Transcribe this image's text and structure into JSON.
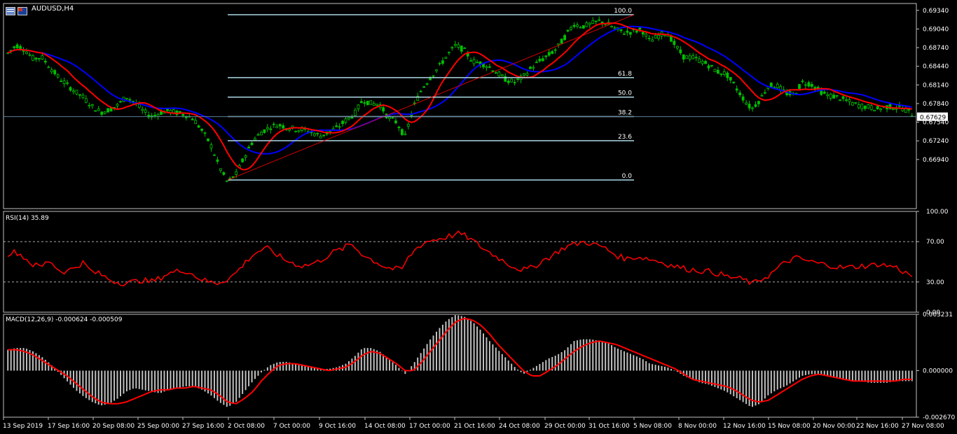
{
  "window": {
    "title": "AUDUSD,H4"
  },
  "colors": {
    "background": "#000000",
    "frame": "#c0c0c0",
    "candle": "#00c000",
    "fast_ma": "#ff0000",
    "slow_ma": "#0000ff",
    "fibo": "#add8e6",
    "rsi": "#ff0000",
    "macd_hist": "#c0c0c0",
    "macd_signal": "#ff0000",
    "price_line": "#5f7d96"
  },
  "chart_data": [
    {
      "type": "candlestick",
      "title": "AUDUSD,H4",
      "ylim": [
        0.6615,
        0.6945
      ],
      "y_ticks": [
        "0.69340",
        "0.69040",
        "0.68740",
        "0.68440",
        "0.68140",
        "0.67840",
        "0.67540",
        "0.67240",
        "0.66940"
      ],
      "current_price": "0.67629",
      "x_ticks": [
        "13 Sep 2019",
        "17 Sep 16:00",
        "20 Sep 08:00",
        "25 Sep 00:00",
        "27 Sep 16:00",
        "2 Oct 08:00",
        "7 Oct 00:00",
        "9 Oct 16:00",
        "14 Oct 08:00",
        "17 Oct 00:00",
        "21 Oct 16:00",
        "24 Oct 08:00",
        "29 Oct 00:00",
        "31 Oct 16:00",
        "5 Nov 08:00",
        "8 Nov 00:00",
        "12 Nov 16:00",
        "15 Nov 08:00",
        "20 Nov 00:00",
        "22 Nov 16:00",
        "27 Nov 08:00"
      ],
      "price_path": [
        0.6865,
        0.6878,
        0.6871,
        0.6856,
        0.6859,
        0.6842,
        0.6826,
        0.6814,
        0.6803,
        0.6793,
        0.6779,
        0.677,
        0.6774,
        0.6781,
        0.6795,
        0.6786,
        0.6772,
        0.6763,
        0.6769,
        0.6773,
        0.6769,
        0.6766,
        0.6759,
        0.674,
        0.6718,
        0.6683,
        0.6657,
        0.667,
        0.6698,
        0.6724,
        0.6738,
        0.6746,
        0.675,
        0.6746,
        0.6743,
        0.6742,
        0.6737,
        0.6732,
        0.6738,
        0.6745,
        0.6757,
        0.6767,
        0.679,
        0.6784,
        0.6783,
        0.6761,
        0.6754,
        0.673,
        0.6778,
        0.6808,
        0.6826,
        0.6843,
        0.6862,
        0.6878,
        0.687,
        0.6852,
        0.6849,
        0.6843,
        0.6832,
        0.6822,
        0.6818,
        0.6827,
        0.6842,
        0.6853,
        0.6862,
        0.6873,
        0.6893,
        0.6912,
        0.6908,
        0.6912,
        0.6917,
        0.6912,
        0.6903,
        0.6898,
        0.69,
        0.6903,
        0.6884,
        0.6893,
        0.6899,
        0.6877,
        0.6859,
        0.6858,
        0.6853,
        0.6845,
        0.6835,
        0.6832,
        0.6813,
        0.6793,
        0.6775,
        0.679,
        0.6813,
        0.6813,
        0.6801,
        0.6798,
        0.6818,
        0.6816,
        0.6805,
        0.6797,
        0.6795,
        0.679,
        0.6784,
        0.678,
        0.6778,
        0.6775,
        0.6779,
        0.6778,
        0.6776,
        0.6767
      ],
      "fibonacci": {
        "levels": [
          {
            "label": "100.0",
            "price": 0.6927
          },
          {
            "label": "61.8",
            "price": 0.68257
          },
          {
            "label": "50.0",
            "price": 0.67944
          },
          {
            "label": "38.2",
            "price": 0.67631
          },
          {
            "label": "23.6",
            "price": 0.67243
          },
          {
            "label": "0.0",
            "price": 0.6661
          }
        ]
      }
    },
    {
      "type": "line",
      "title": "RSI(14) 35.89",
      "ylim": [
        0,
        100
      ],
      "y_ticks": [
        "100.00",
        "70.00",
        "30.00",
        "0.00"
      ],
      "levels": [
        70,
        30
      ],
      "values": [
        58,
        60,
        54,
        47,
        45,
        52,
        42,
        40,
        45,
        49,
        40,
        38,
        33,
        30,
        29,
        30,
        32,
        30,
        33,
        38,
        40,
        42,
        38,
        33,
        30,
        29,
        32,
        37,
        46,
        55,
        61,
        63,
        58,
        52,
        49,
        46,
        47,
        50,
        55,
        60,
        63,
        68,
        60,
        54,
        50,
        45,
        43,
        42,
        56,
        65,
        70,
        72,
        74,
        76,
        78,
        74,
        68,
        62,
        57,
        52,
        47,
        43,
        42,
        46,
        52,
        56,
        62,
        66,
        68,
        70,
        67,
        65,
        60,
        55,
        53,
        55,
        54,
        52,
        50,
        47,
        45,
        43,
        42,
        41,
        40,
        38,
        35,
        34,
        32,
        28,
        33,
        37,
        44,
        50,
        54,
        52,
        50,
        48,
        47,
        45,
        44,
        45,
        46,
        46,
        48,
        46,
        45,
        40,
        36
      ]
    },
    {
      "type": "bar",
      "title": "MACD(12,26,9) -0.000624 -0.000509",
      "ylim": [
        -0.00267,
        0.003231
      ],
      "y_ticks": [
        "0.003231",
        "0.000000",
        "-0.002670"
      ],
      "macd": [
        0.0012,
        0.0013,
        0.0013,
        0.0011,
        0.0008,
        0.0004,
        -0.0001,
        -0.0006,
        -0.0011,
        -0.0015,
        -0.0018,
        -0.002,
        -0.0019,
        -0.0016,
        -0.0012,
        -0.001,
        -0.0011,
        -0.0012,
        -0.0013,
        -0.0011,
        -0.001,
        -0.0009,
        -0.0009,
        -0.0011,
        -0.0014,
        -0.0018,
        -0.0021,
        -0.0018,
        -0.0012,
        -0.0006,
        -0.0001,
        0.0003,
        0.0005,
        0.0005,
        0.0004,
        0.0003,
        0.0002,
        0.0001,
        0.0001,
        0.0002,
        0.0004,
        0.0008,
        0.0013,
        0.0013,
        0.0011,
        0.0007,
        0.0003,
        -0.0002,
        0.0004,
        0.0011,
        0.0018,
        0.0024,
        0.0029,
        0.0032,
        0.0031,
        0.0028,
        0.0023,
        0.0017,
        0.0012,
        0.0007,
        0.0002,
        -0.0002,
        0.0001,
        0.0004,
        0.0007,
        0.0009,
        0.0012,
        0.0017,
        0.0018,
        0.0018,
        0.0017,
        0.0016,
        0.0013,
        0.0011,
        0.0009,
        0.0007,
        0.0004,
        0.0003,
        0.0002,
        0.0,
        -0.0003,
        -0.0005,
        -0.0007,
        -0.0008,
        -0.001,
        -0.0012,
        -0.0015,
        -0.0018,
        -0.0021,
        -0.0019,
        -0.0014,
        -0.0011,
        -0.0009,
        -0.0006,
        -0.0003,
        -0.0002,
        -0.0002,
        -0.0003,
        -0.0004,
        -0.0005,
        -0.0006,
        -0.0006,
        -0.0007,
        -0.0007,
        -0.0007,
        -0.0006,
        -0.0006,
        -0.0006
      ],
      "signal": [
        0.0012,
        0.0012,
        0.0011,
        0.0009,
        0.0006,
        0.0003,
        0.0,
        -0.0003,
        -0.0007,
        -0.0011,
        -0.0015,
        -0.0018,
        -0.0019,
        -0.0019,
        -0.0018,
        -0.0016,
        -0.0014,
        -0.0012,
        -0.0011,
        -0.0011,
        -0.001,
        -0.001,
        -0.0009,
        -0.001,
        -0.0011,
        -0.0014,
        -0.0018,
        -0.0019,
        -0.0016,
        -0.0012,
        -0.0006,
        -0.0001,
        0.0003,
        0.0004,
        0.0004,
        0.0003,
        0.0002,
        0.0001,
        0.0,
        0.0001,
        0.0002,
        0.0005,
        0.0009,
        0.0011,
        0.001,
        0.0007,
        0.0004,
        0.0,
        0.0,
        0.0005,
        0.0011,
        0.0017,
        0.0023,
        0.0028,
        0.003,
        0.0029,
        0.0026,
        0.0021,
        0.0015,
        0.001,
        0.0005,
        0.0,
        -0.0003,
        -0.0003,
        0.0,
        0.0003,
        0.0007,
        0.0011,
        0.0014,
        0.0016,
        0.0017,
        0.0016,
        0.0015,
        0.0013,
        0.0011,
        0.0009,
        0.0007,
        0.0005,
        0.0003,
        0.0001,
        -0.0002,
        -0.0005,
        -0.0006,
        -0.0007,
        -0.0008,
        -0.0009,
        -0.0011,
        -0.0014,
        -0.0017,
        -0.0018,
        -0.0017,
        -0.0014,
        -0.0011,
        -0.0008,
        -0.0005,
        -0.0003,
        -0.0002,
        -0.0003,
        -0.0004,
        -0.0005,
        -0.0006,
        -0.0006,
        -0.0006,
        -0.0006,
        -0.0006,
        -0.0006,
        -0.0005,
        -0.0005
      ]
    }
  ]
}
